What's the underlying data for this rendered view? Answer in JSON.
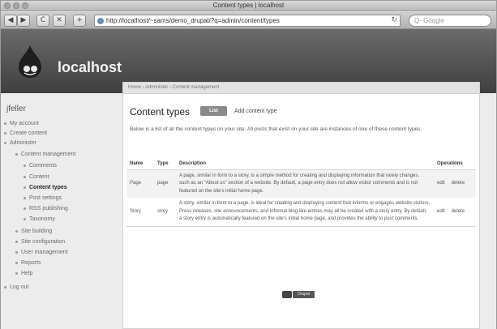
{
  "window": {
    "title": "Content types | localhost"
  },
  "toolbar": {
    "back": "◀",
    "forward": "▶",
    "reload": "C",
    "stop": "✕",
    "add": "+",
    "url": "http://localhost/~sams/demo_drupal/?q=admin/content/types",
    "reload_icon": "↻",
    "search_placeholder": "Q- Google"
  },
  "header": {
    "site_name": "localhost"
  },
  "sidebar": {
    "user": "jfeller",
    "items": [
      {
        "label": "My account",
        "level": 0
      },
      {
        "label": "Create content",
        "level": 0
      },
      {
        "label": "Administer",
        "level": 0
      },
      {
        "label": "Content management",
        "level": 1
      },
      {
        "label": "Comments",
        "level": 2
      },
      {
        "label": "Content",
        "level": 2
      },
      {
        "label": "Content types",
        "level": 2,
        "active": true
      },
      {
        "label": "Post settings",
        "level": 2
      },
      {
        "label": "RSS publishing",
        "level": 2
      },
      {
        "label": "Taxonomy",
        "level": 2
      },
      {
        "label": "Site building",
        "level": 1
      },
      {
        "label": "Site configuration",
        "level": 1
      },
      {
        "label": "User management",
        "level": 1
      },
      {
        "label": "Reports",
        "level": 1
      },
      {
        "label": "Help",
        "level": 1
      },
      {
        "label": "Log out",
        "level": 0
      }
    ]
  },
  "content": {
    "breadcrumb": "Home › Administer › Content management",
    "title": "Content types",
    "tab_list": "List",
    "tab_add": "Add content type",
    "intro": "Below is a list of all the content types on your site. All posts that exist on your site are instances of one of these content types.",
    "columns": [
      "Name",
      "Type",
      "Description",
      "Operations"
    ],
    "rows": [
      {
        "name": "Page",
        "type": "page",
        "description": "A page, similar in form to a story, is a simple method for creating and displaying information that rarely changes, such as an \"About us\" section of a website. By default, a page entry does not allow visitor comments and is not featured on the site's initial home page.",
        "edit": "edit",
        "delete": "delete"
      },
      {
        "name": "Story",
        "type": "story",
        "description": "A story, similar in form to a page, is ideal for creating and displaying content that informs or engages website visitors. Press releases, site announcements, and informal blog-like entries may all be created with a story entry. By default, a story entry is automatically featured on the site's initial home page, and provides the ability to post comments.",
        "edit": "edit",
        "delete": "delete"
      }
    ],
    "footer_badge": "Drupal"
  }
}
